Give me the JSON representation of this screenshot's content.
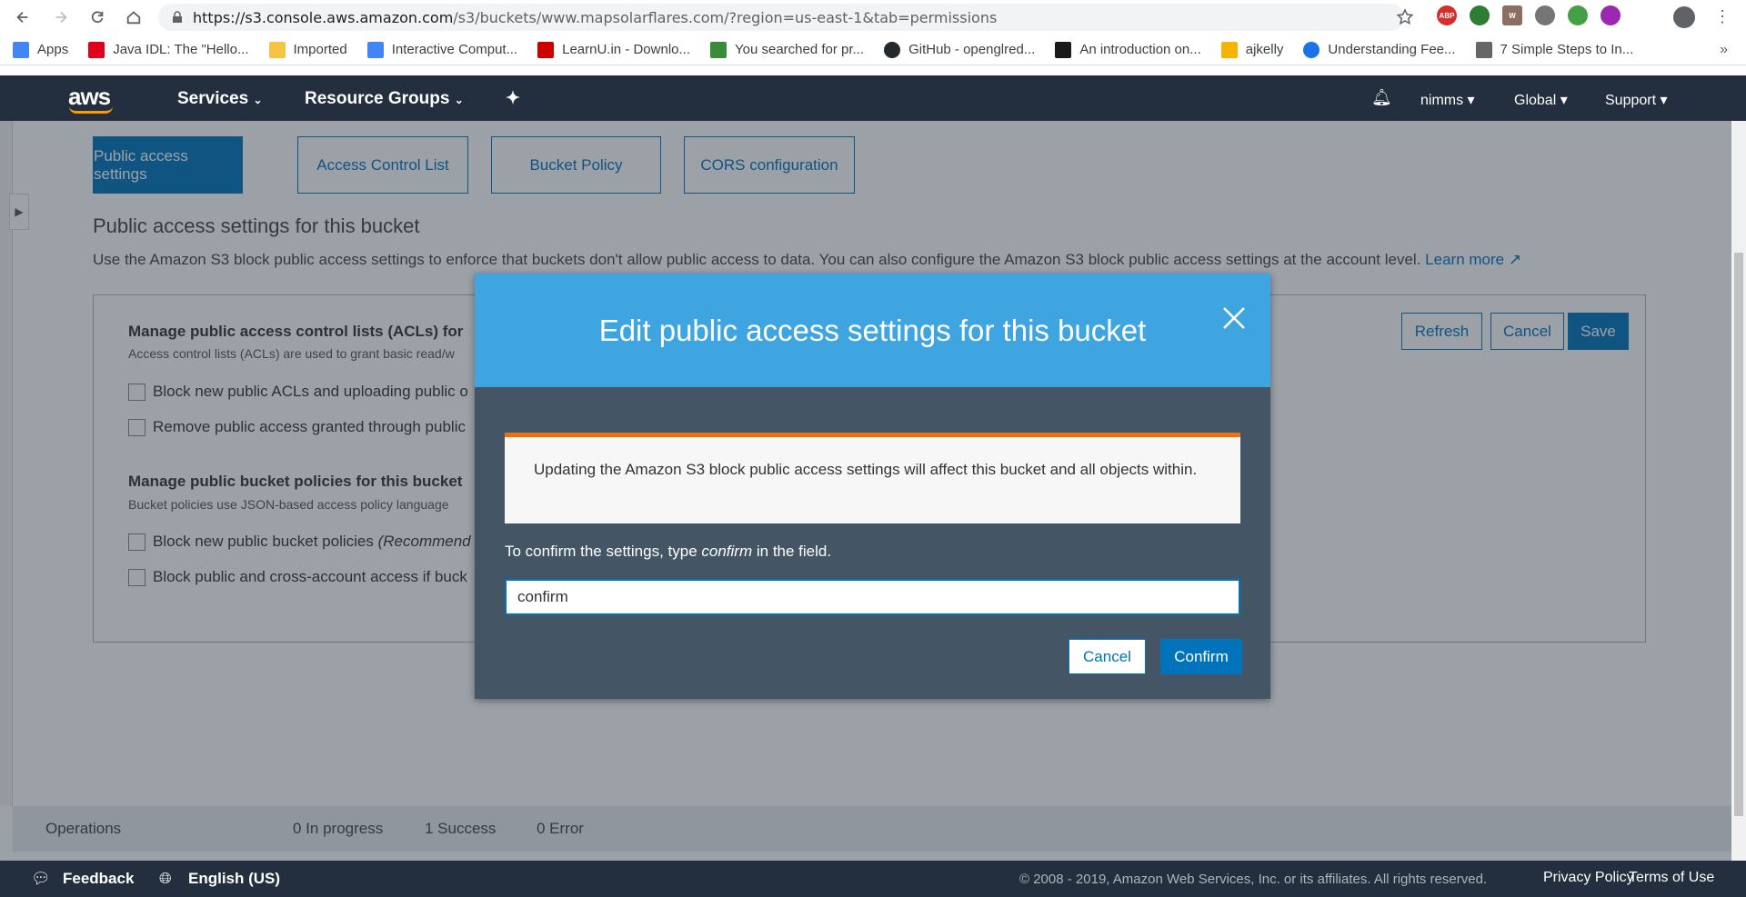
{
  "browser": {
    "url_host": "https://s3.console.aws.amazon.com",
    "url_path": "/s3/buckets/www.mapsolarflares.com/?region=us-east-1&tab=permissions",
    "bookmarks": [
      {
        "label": "Apps",
        "icon": "apps-grid-icon",
        "color": "#4285f4"
      },
      {
        "label": "Java IDL: The \"Hello...",
        "icon": "oracle-icon",
        "color": "#e0001b"
      },
      {
        "label": "Imported",
        "icon": "folder-icon",
        "color": "#f6c343"
      },
      {
        "label": "Interactive Comput...",
        "icon": "table-icon",
        "color": "#4285f4"
      },
      {
        "label": "LearnU.in - Downlo...",
        "icon": "lu-icon",
        "color": "#cc0000"
      },
      {
        "label": "You searched for pr...",
        "icon": "u-icon",
        "color": "#3b8a3a"
      },
      {
        "label": "GitHub - openglred...",
        "icon": "github-icon",
        "color": "#24292e"
      },
      {
        "label": "An introduction on...",
        "icon": "terminal-icon",
        "color": "#1a1a1a"
      },
      {
        "label": "ajkelly",
        "icon": "cookie-icon",
        "color": "#f4b400"
      },
      {
        "label": "Understanding Fee...",
        "icon": "circle-icon",
        "color": "#1a73e8"
      },
      {
        "label": "7 Simple Steps to In...",
        "icon": "saint-icon",
        "color": "#666666"
      }
    ]
  },
  "aws_nav": {
    "logo": "aws",
    "services": "Services",
    "resource_groups": "Resource Groups",
    "user": "nimms",
    "region": "Global",
    "support": "Support"
  },
  "tabs": [
    {
      "label": "Public access settings",
      "active": true
    },
    {
      "label": "Access Control List",
      "active": false
    },
    {
      "label": "Bucket Policy",
      "active": false
    },
    {
      "label": "CORS configuration",
      "active": false
    }
  ],
  "section": {
    "title": "Public access settings for this bucket",
    "description": "Use the Amazon S3 block public access settings to enforce that buckets don't allow public access to data. You can also configure the Amazon S3 block public access settings at the account level.",
    "learn_more": "Learn more"
  },
  "panel": {
    "acl_heading": "Manage public access control lists (ACLs) for",
    "acl_sub": "Access control lists (ACLs) are used to grant basic read/w",
    "acl_cb1": "Block new public ACLs and uploading public o",
    "acl_cb2": "Remove public access granted through public",
    "policy_heading": "Manage public bucket policies for this bucket",
    "policy_sub": "Bucket policies use JSON-based access policy language",
    "policy_cb1": "Block new public bucket policies",
    "policy_cb1_suffix": "(Recommend",
    "policy_cb2": "Block public and cross-account access if buck",
    "refresh": "Refresh",
    "cancel": "Cancel",
    "save": "Save"
  },
  "operations": {
    "label": "Operations",
    "in_progress": "0 In progress",
    "success": "1 Success",
    "error": "0 Error"
  },
  "footer": {
    "feedback": "Feedback",
    "language": "English (US)",
    "copyright": "© 2008 - 2019, Amazon Web Services, Inc. or its affiliates. All rights reserved.",
    "privacy": "Privacy Policy",
    "terms": "Terms of Use"
  },
  "modal": {
    "title": "Edit public access settings for this bucket",
    "alert": "Updating the Amazon S3 block public access settings will affect this bucket and all objects within.",
    "confirm_prefix": "To confirm the settings, type",
    "confirm_word": "confirm",
    "confirm_suffix": "in the field.",
    "input_value": "confirm",
    "cancel": "Cancel",
    "confirm": "Confirm"
  },
  "colors": {
    "aws_nav_bg": "#232f3e",
    "accent_blue": "#0073bb",
    "modal_header": "#3fa5e0",
    "modal_body": "#445565",
    "alert_border": "#ec7211"
  }
}
